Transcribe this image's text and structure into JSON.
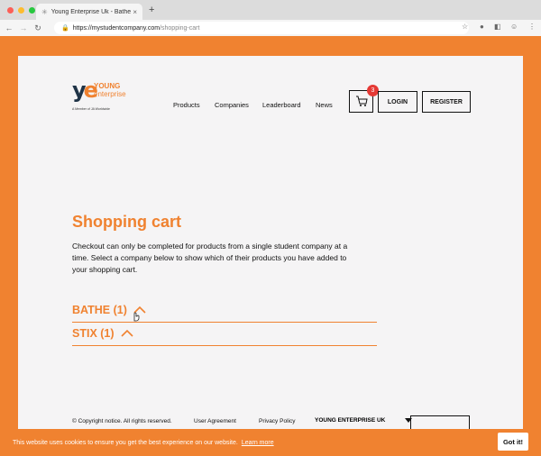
{
  "browser": {
    "tab_title": "Young Enterprise Uk - Bathe",
    "tab_close": "×",
    "new_tab": "+",
    "url_host": "https://mystudentcompany.com",
    "url_path": "/shopping-cart"
  },
  "header": {
    "logo_mark_y": "y",
    "logo_mark_e": "e",
    "logo_young": "YOUNG",
    "logo_enterprise": "enterprise",
    "logo_tagline": "A Member of JA Worldwide",
    "nav": [
      "Products",
      "Companies",
      "Leaderboard",
      "News"
    ],
    "cart_count": "3",
    "login": "LOGIN",
    "register": "REGISTER"
  },
  "main": {
    "title": "Shopping cart",
    "description": "Checkout can only be completed for products from a single student company at a time. Select a company below to show which of their products you have added to your shopping cart.",
    "companies": [
      {
        "label": "BATHE (1)"
      },
      {
        "label": "STIX (1)"
      }
    ]
  },
  "footer": {
    "copyright": "© Copyright notice. All rights reserved.",
    "user_agreement": "User Agreement",
    "privacy": "Privacy Policy",
    "org_select": "YOUNG ENTERPRISE UK"
  },
  "cookie": {
    "message": "This website uses cookies to ensure you get the best experience on our website.",
    "learn_more": "Learn more",
    "accept": "Got it!"
  },
  "colors": {
    "brand_orange": "#f08230",
    "navy": "#1f3347",
    "badge_red": "#e53935"
  }
}
